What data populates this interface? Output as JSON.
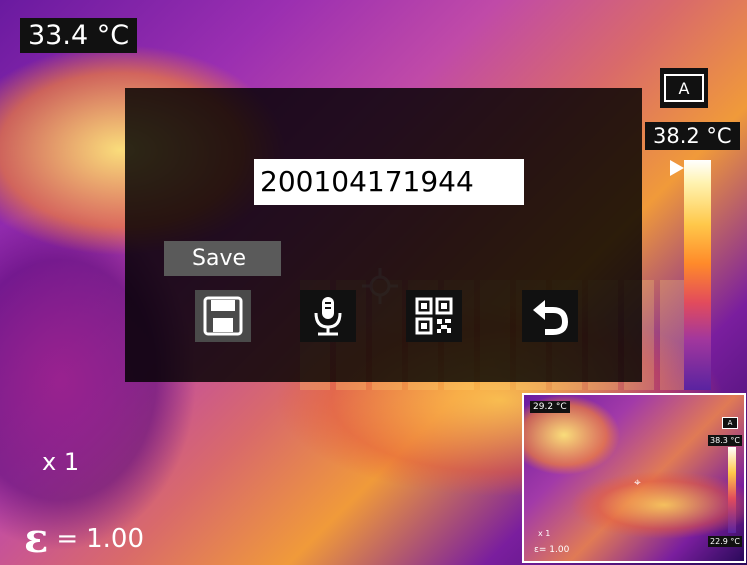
{
  "display": {
    "spot_temperature": "33.4 °C",
    "max_temperature": "38.2 °C",
    "mode_label": "A",
    "zoom": "x 1",
    "emissivity_symbol": "ε",
    "emissivity_eq": "=",
    "emissivity_value": "1.00"
  },
  "dialog": {
    "file_name": "200104171944",
    "selected_label": "Save",
    "actions": [
      {
        "id": "save",
        "icon": "save-icon"
      },
      {
        "id": "voice",
        "icon": "microphone-icon"
      },
      {
        "id": "qr",
        "icon": "qr-code-icon"
      },
      {
        "id": "back",
        "icon": "back-arrow-icon"
      }
    ]
  },
  "preview": {
    "spot_temperature": "29.2 °C",
    "max_temperature": "38.3 °C",
    "min_temperature": "22.9 °C",
    "mode_label": "A",
    "zoom": "x 1",
    "emissivity": "ε= 1.00"
  }
}
